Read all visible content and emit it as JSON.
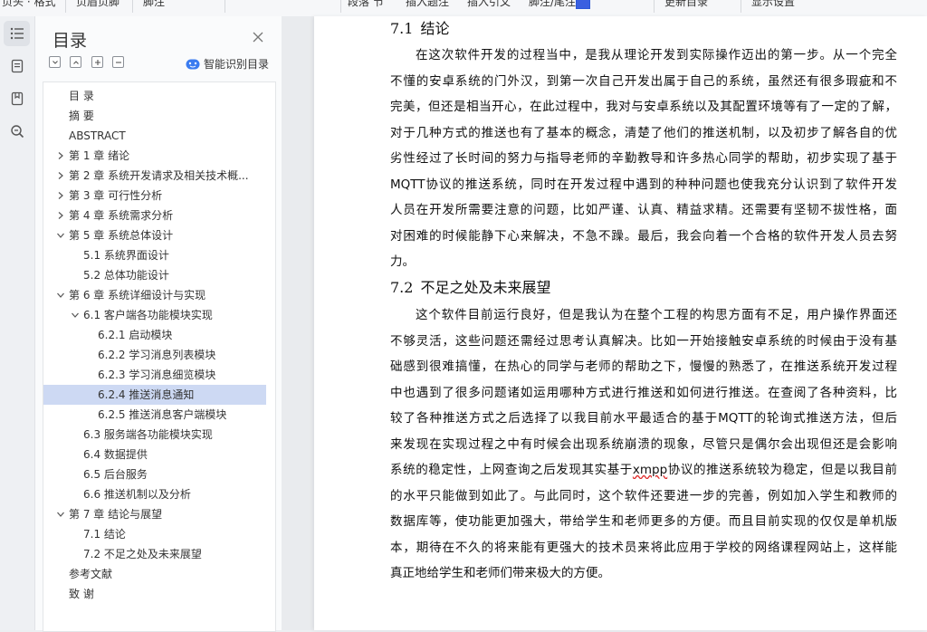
{
  "toolbar": {
    "items": [
      "页头 · 格式",
      "页眉页脚",
      "脚注",
      "段落",
      "节",
      "插入题注",
      "插入引文",
      "脚注/尾注",
      "更新目录",
      "显示设置"
    ]
  },
  "nav": {
    "title": "目录",
    "smart_label": "智能识别目录",
    "toc": [
      {
        "label": "目  录",
        "level": 0,
        "state": "none"
      },
      {
        "label": "摘  要",
        "level": 0,
        "state": "none"
      },
      {
        "label": "ABSTRACT",
        "level": 0,
        "state": "none"
      },
      {
        "label": "第 1 章  绪论",
        "level": 0,
        "state": "collapsed"
      },
      {
        "label": "第 2 章  系统开发请求及相关技术概...",
        "level": 0,
        "state": "collapsed"
      },
      {
        "label": "第 3 章  可行性分析",
        "level": 0,
        "state": "collapsed"
      },
      {
        "label": "第 4 章  系统需求分析",
        "level": 0,
        "state": "collapsed"
      },
      {
        "label": "第 5 章  系统总体设计",
        "level": 0,
        "state": "expanded"
      },
      {
        "label": "5.1  系统界面设计",
        "level": 1,
        "state": "none"
      },
      {
        "label": "5.2  总体功能设计",
        "level": 1,
        "state": "none"
      },
      {
        "label": "第 6 章  系统详细设计与实现",
        "level": 0,
        "state": "expanded"
      },
      {
        "label": "6.1  客户端各功能模块实现",
        "level": 1,
        "state": "expanded"
      },
      {
        "label": "6.2.1  启动模块",
        "level": 2,
        "state": "none"
      },
      {
        "label": "6.2.2  学习消息列表模块",
        "level": 2,
        "state": "none"
      },
      {
        "label": "6.2.3  学习消息细览模块",
        "level": 2,
        "state": "none"
      },
      {
        "label": "6.2.4  推送消息通知",
        "level": 2,
        "state": "none",
        "selected": true
      },
      {
        "label": "6.2.5  推送消息客户端模块",
        "level": 2,
        "state": "none"
      },
      {
        "label": "6.3  服务端各功能模块实现",
        "level": 1,
        "state": "none"
      },
      {
        "label": "6.4  数据提供",
        "level": 1,
        "state": "none"
      },
      {
        "label": "6.5  后台服务",
        "level": 1,
        "state": "none"
      },
      {
        "label": "6.6  推送机制以及分析",
        "level": 1,
        "state": "none"
      },
      {
        "label": "第 7 章  结论与展望",
        "level": 0,
        "state": "expanded"
      },
      {
        "label": "7.1  结论",
        "level": 1,
        "state": "none"
      },
      {
        "label": "7.2  不足之处及未来展望",
        "level": 1,
        "state": "none"
      },
      {
        "label": "参考文献",
        "level": 0,
        "state": "none"
      },
      {
        "label": "致    谢",
        "level": 0,
        "state": "none"
      }
    ]
  },
  "doc": {
    "h1": {
      "num": "7.1",
      "text": "结论"
    },
    "p1": [
      "在这次软件开发的过程当中，是我从理论开发到实际操作迈出的第一步。从一个完全",
      "不懂的安卓系统的门外汉，到第一次自己开发出属于自己的系统，虽然还有很多瑕疵和不",
      "完美，但还是相当开心，在此过程中，我对与安卓系统以及其配置环境等有了一定的了解，",
      "对于几种方式的推送也有了基本的概念，清楚了他们的推送机制，以及初步了解各自的优",
      "劣性经过了长时间的努力与指导老师的辛勤教导和许多热心同学的帮助，初步实现了基于",
      "MQTT协议的推送系统，同时在开发过程中遇到的种种问题也使我充分认识到了软件开发",
      "人员在开发所需要注意的问题，比如严谨、认真、精益求精。还需要有坚韧不拔性格，面",
      "对困难的时候能静下心来解决，不急不躁。最后，我会向着一个合格的软件开发人员去努",
      "力。"
    ],
    "h2": {
      "num": "7.2",
      "text": "不足之处及未来展望"
    },
    "p2": [
      "这个软件目前运行良好，但是我认为在整个工程的构思方面有不足，用户操作界面还",
      "不够灵活，这些问题还需经过思考认真解决。比如一开始接触安卓系统的时候由于没有基",
      "础感到很难搞懂，在热心的同学与老师的帮助之下，慢慢的熟悉了，在推送系统开发过程",
      "中也遇到了很多问题诸如运用哪种方式进行推送和如何进行推送。在查阅了各种资料，比",
      "较了各种推送方式之后选择了以我目前水平最适合的基于MQTT的轮询式推送方法，但后",
      "来发现在实现过程之中有时候会出现系统崩溃的现象，尽管只是偶尔会出现但还是会影响",
      "系统的稳定性，上网查询之后发现其实基于xmpp协议的推送系统较为稳定，但是以我目前",
      "的水平只能做到如此了。与此同时，这个软件还要进一步的完善，例如加入学生和教师的",
      "数据库等，使功能更加强大，带给学生和老师更多的方便。而且目前实现的仅仅是单机版",
      "本，期待在不久的将来能有更强大的技术员来将此应用于学校的网络课程网站上，这样能",
      "真正地给学生和老师们带来极大的方便。"
    ]
  }
}
